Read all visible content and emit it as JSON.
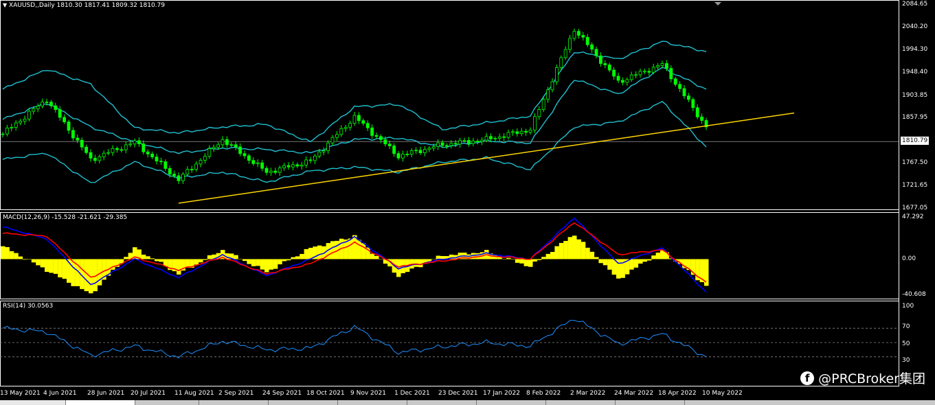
{
  "header": {
    "symbol_line": "XAUUSD,,Daily  1810.30 1817.41 1809.32 1810.79"
  },
  "macd_header": "MACD(12,26,9) -15.528 -21.621 -29.385",
  "rsi_header": "RSI(14) 30.0563",
  "current_price": "1810.79",
  "price_axis": [
    "2084.65",
    "2040.20",
    "1994.30",
    "1948.40",
    "1903.85",
    "1857.95",
    "1767.50",
    "1721.65",
    "1677.05"
  ],
  "macd_axis": [
    "47.292",
    "0.00",
    "-40.608"
  ],
  "rsi_axis": [
    "100",
    "70",
    "50",
    "30"
  ],
  "time_axis": [
    "13 May 2021",
    "4 Jun 2021",
    "28 Jun 2021",
    "20 Jul 2021",
    "11 Aug 2021",
    "2 Sep 2021",
    "24 Sep 2021",
    "18 Oct 2021",
    "9 Nov 2021",
    "1 Dec 2021",
    "23 Dec 2021",
    "17 Jan 2022",
    "8 Feb 2022",
    "2 Mar 2022",
    "24 Mar 2022",
    "18 Apr 2022",
    "10 May 2022"
  ],
  "watermark": {
    "icon": "facebook-icon",
    "text": "@PRCBroker集团"
  },
  "colors": {
    "candles": "#00ff00",
    "bollinger": "#20c0d0",
    "trendline": "#ffd700",
    "histogram": "#ffff00",
    "macd_line": "#0000ff",
    "signal_line": "#ff0000",
    "rsi_line": "#1e90ff"
  },
  "chart_data": [
    {
      "type": "candlestick",
      "title": "XAUUSD,,Daily",
      "ohlc_last": {
        "open": 1810.3,
        "high": 1817.41,
        "low": 1809.32,
        "close": 1810.79
      },
      "ylim": [
        1677.05,
        2084.65
      ],
      "x": [
        "13 May 2021",
        "4 Jun 2021",
        "28 Jun 2021",
        "20 Jul 2021",
        "11 Aug 2021",
        "2 Sep 2021",
        "24 Sep 2021",
        "18 Oct 2021",
        "9 Nov 2021",
        "1 Dec 2021",
        "23 Dec 2021",
        "17 Jan 2022",
        "8 Feb 2022",
        "2 Mar 2022",
        "24 Mar 2022",
        "18 Apr 2022",
        "10 May 2022"
      ],
      "close": [
        1826,
        1895,
        1775,
        1810,
        1735,
        1815,
        1750,
        1772,
        1860,
        1782,
        1805,
        1815,
        1835,
        2035,
        1930,
        1965,
        1840
      ],
      "bb_upper": [
        1915,
        1955,
        1925,
        1838,
        1828,
        1840,
        1845,
        1810,
        1880,
        1885,
        1835,
        1848,
        1862,
        1990,
        1975,
        2010,
        1990
      ],
      "bb_middle": [
        1855,
        1888,
        1840,
        1810,
        1788,
        1798,
        1795,
        1788,
        1815,
        1818,
        1800,
        1812,
        1808,
        1935,
        1905,
        1958,
        1915
      ],
      "bb_lower": [
        1775,
        1788,
        1728,
        1770,
        1738,
        1750,
        1730,
        1752,
        1760,
        1750,
        1770,
        1778,
        1755,
        1840,
        1850,
        1890,
        1800
      ],
      "trendline": {
        "from": {
          "x": "11 Aug 2021",
          "y": 1688
        },
        "to": {
          "x": "10 May 2022",
          "y": 1842
        }
      }
    },
    {
      "type": "bar+line",
      "title": "MACD(12,26,9)",
      "values_last": {
        "macd": -15.528,
        "signal": -21.621,
        "histogram": -29.385
      },
      "ylim": [
        -40.608,
        47.292
      ],
      "histogram": [
        14,
        -12,
        -38,
        12,
        -16,
        10,
        -14,
        12,
        25,
        -18,
        4,
        8,
        -8,
        27,
        -22,
        10,
        -29
      ],
      "macd_line": [
        35,
        22,
        -28,
        0,
        -20,
        5,
        -18,
        0,
        24,
        -10,
        0,
        6,
        0,
        45,
        -5,
        12,
        -36
      ],
      "signal_line": [
        28,
        25,
        -20,
        2,
        -12,
        2,
        -16,
        -5,
        18,
        -8,
        -2,
        4,
        0,
        40,
        5,
        10,
        -25
      ]
    },
    {
      "type": "line",
      "title": "RSI(14)",
      "value_last": 30.0563,
      "ylim": [
        0,
        100
      ],
      "levels": [
        70,
        50,
        30
      ],
      "values": [
        70,
        65,
        32,
        45,
        30,
        52,
        40,
        42,
        72,
        36,
        44,
        50,
        45,
        84,
        48,
        62,
        30
      ]
    }
  ]
}
